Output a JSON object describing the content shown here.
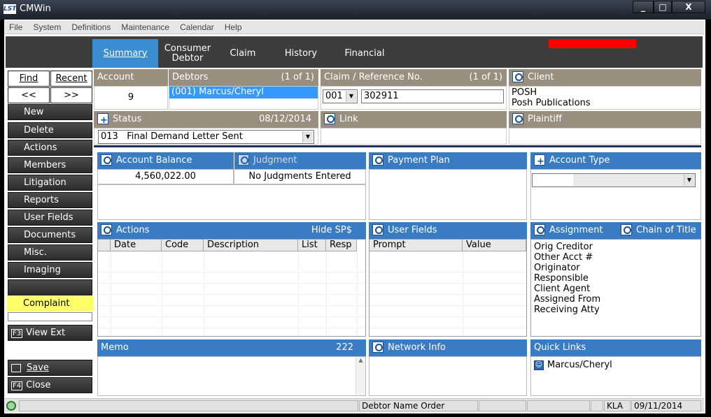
{
  "window": {
    "title": "CMWin",
    "logo": "LST",
    "min_label": "_",
    "max_label": "□",
    "close_label": "X"
  },
  "menu": [
    "File",
    "System",
    "Definitions",
    "Maintenance",
    "Calendar",
    "Help"
  ],
  "tabs": [
    {
      "label": "Summary"
    },
    {
      "label1": "Consumer",
      "label2": "Debtor"
    },
    {
      "label": "Claim"
    },
    {
      "label": "History"
    },
    {
      "label": "Financial"
    }
  ],
  "sidebar": {
    "find": "Find",
    "recent": "Recent",
    "prev": "<<",
    "next": ">>",
    "items": [
      "New",
      "Delete",
      "Actions",
      "Members",
      "Litigation",
      "Reports",
      "User Fields",
      "Documents",
      "Misc.",
      "Imaging"
    ],
    "complaint": "Complaint",
    "view_ext_key": "F3",
    "view_ext": "View Ext",
    "save": "Save",
    "close_key": "F4",
    "close": "Close"
  },
  "account": {
    "header": "Account",
    "value": "9"
  },
  "debtors": {
    "header": "Debtors",
    "count": "(1 of 1)",
    "value": "(001) Marcus/Cheryl"
  },
  "claim": {
    "header": "Claim / Reference No.",
    "count": "(1 of 1)",
    "num": "001",
    "ref": "302911"
  },
  "client": {
    "header": "Client",
    "line1": "POSH",
    "line2": "Posh Publications"
  },
  "status": {
    "header": "Status",
    "date": "08/12/2014",
    "value": "013   Final Demand Letter Sent"
  },
  "link": {
    "header": "Link"
  },
  "plaintiff": {
    "header": "Plaintiff"
  },
  "account_balance": {
    "header": "Account Balance",
    "value": "4,560,022.00"
  },
  "judgment": {
    "header": "Judgment",
    "value": "No Judgments Entered"
  },
  "payment_plan": {
    "header": "Payment Plan"
  },
  "account_type": {
    "header": "Account Type"
  },
  "actions_panel": {
    "header": "Actions",
    "hide": "Hide SP$",
    "columns": [
      "Date",
      "Code",
      "Description",
      "List",
      "Resp"
    ]
  },
  "user_fields": {
    "header": "User Fields",
    "columns": [
      "Prompt",
      "Value"
    ]
  },
  "assignment": {
    "header": "Assignment",
    "chain": "Chain of Title",
    "items": [
      "Orig Creditor",
      "Other Acct #",
      "Originator",
      "Responsible",
      "Client Agent",
      "Assigned From",
      "Receiving Atty"
    ]
  },
  "memo": {
    "header": "Memo",
    "count": "222"
  },
  "network": {
    "header": "Network Info"
  },
  "quick_links": {
    "header": "Quick Links",
    "item": "Marcus/Cheryl"
  },
  "statusbar": {
    "debtor_order": "Debtor Name Order",
    "user": "KLA",
    "date": "09/11/2014"
  },
  "colors": {
    "tab_active": "#3a8dd0",
    "header_tan": "#9a8f7e",
    "header_blue": "#3a7cc4",
    "highlight": "#ffff66",
    "selection": "#3399ff"
  }
}
